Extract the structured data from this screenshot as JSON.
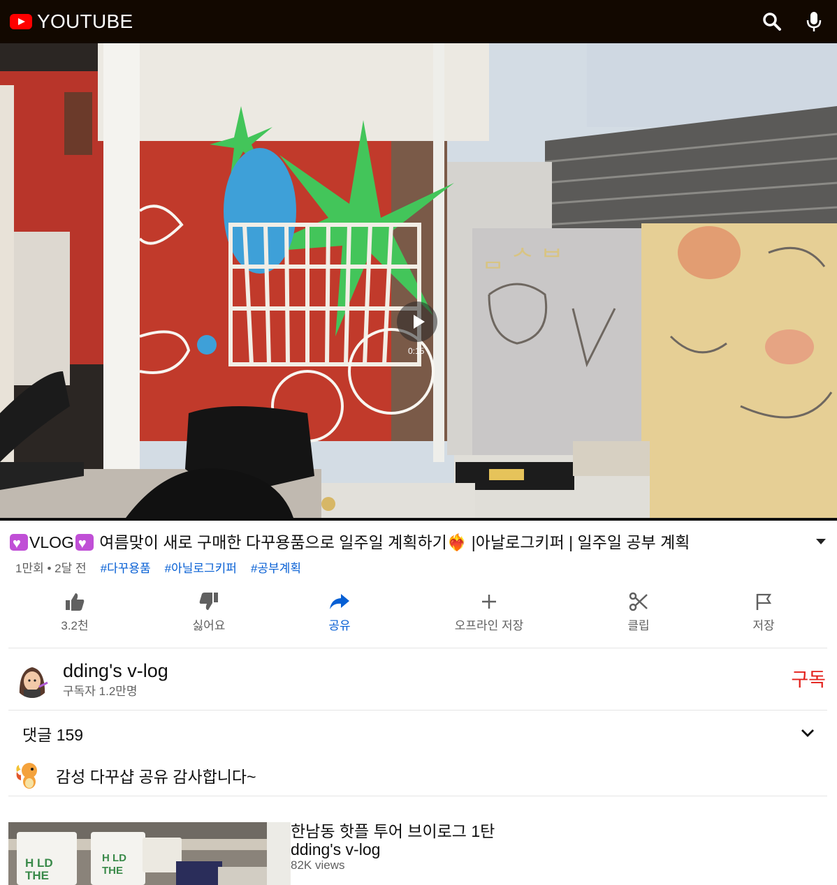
{
  "header": {
    "logo_text": "YOUTUBE",
    "logo_icon": "youtube-play-icon",
    "actions": [
      "search-icon",
      "microphone-icon"
    ],
    "background": "#120800"
  },
  "player": {
    "duration": "0:15",
    "play_icon": "play-icon"
  },
  "video": {
    "title_prefix": "VLOG",
    "title_rest": " 여름맞이 새로 구매한 다꾸용품으로 일주일 계획하기❤️‍🔥 |아날로그키퍼 | 일주일 공부 계획",
    "views": "1만회",
    "separator": "•",
    "age": "2달 전",
    "hashtags": [
      "#다꾸용품",
      "#아닐로그키퍼",
      "#공부계획"
    ]
  },
  "actions": [
    {
      "name": "like",
      "label": "3.2천",
      "icon": "thumbs-up-icon"
    },
    {
      "name": "dislike",
      "label": "싫어요",
      "icon": "thumbs-down-icon"
    },
    {
      "name": "share",
      "label": "공유",
      "icon": "share-arrow-icon"
    },
    {
      "name": "offline-save",
      "label": "오프라인 저장",
      "icon": "plus-icon"
    },
    {
      "name": "clip",
      "label": "클립",
      "icon": "scissors-icon"
    },
    {
      "name": "save",
      "label": "저장",
      "icon": "flag-icon"
    }
  ],
  "channel": {
    "name": "dding's v-log",
    "subscribers": "구독자 1.2만명",
    "subscribe_label": "구독"
  },
  "comments": {
    "header": "댓글 159",
    "top_comment": "감성 다꾸샵 공유 감사합니다~"
  },
  "recommended": [
    {
      "title": "한남동 핫플 투어 브이로그 1탄",
      "channel": "dding's v-log",
      "views": "82K views"
    }
  ],
  "colors": {
    "accent_blue": "#065fd4",
    "subscribe_red": "#e3201b",
    "secondary_text": "#606060"
  }
}
